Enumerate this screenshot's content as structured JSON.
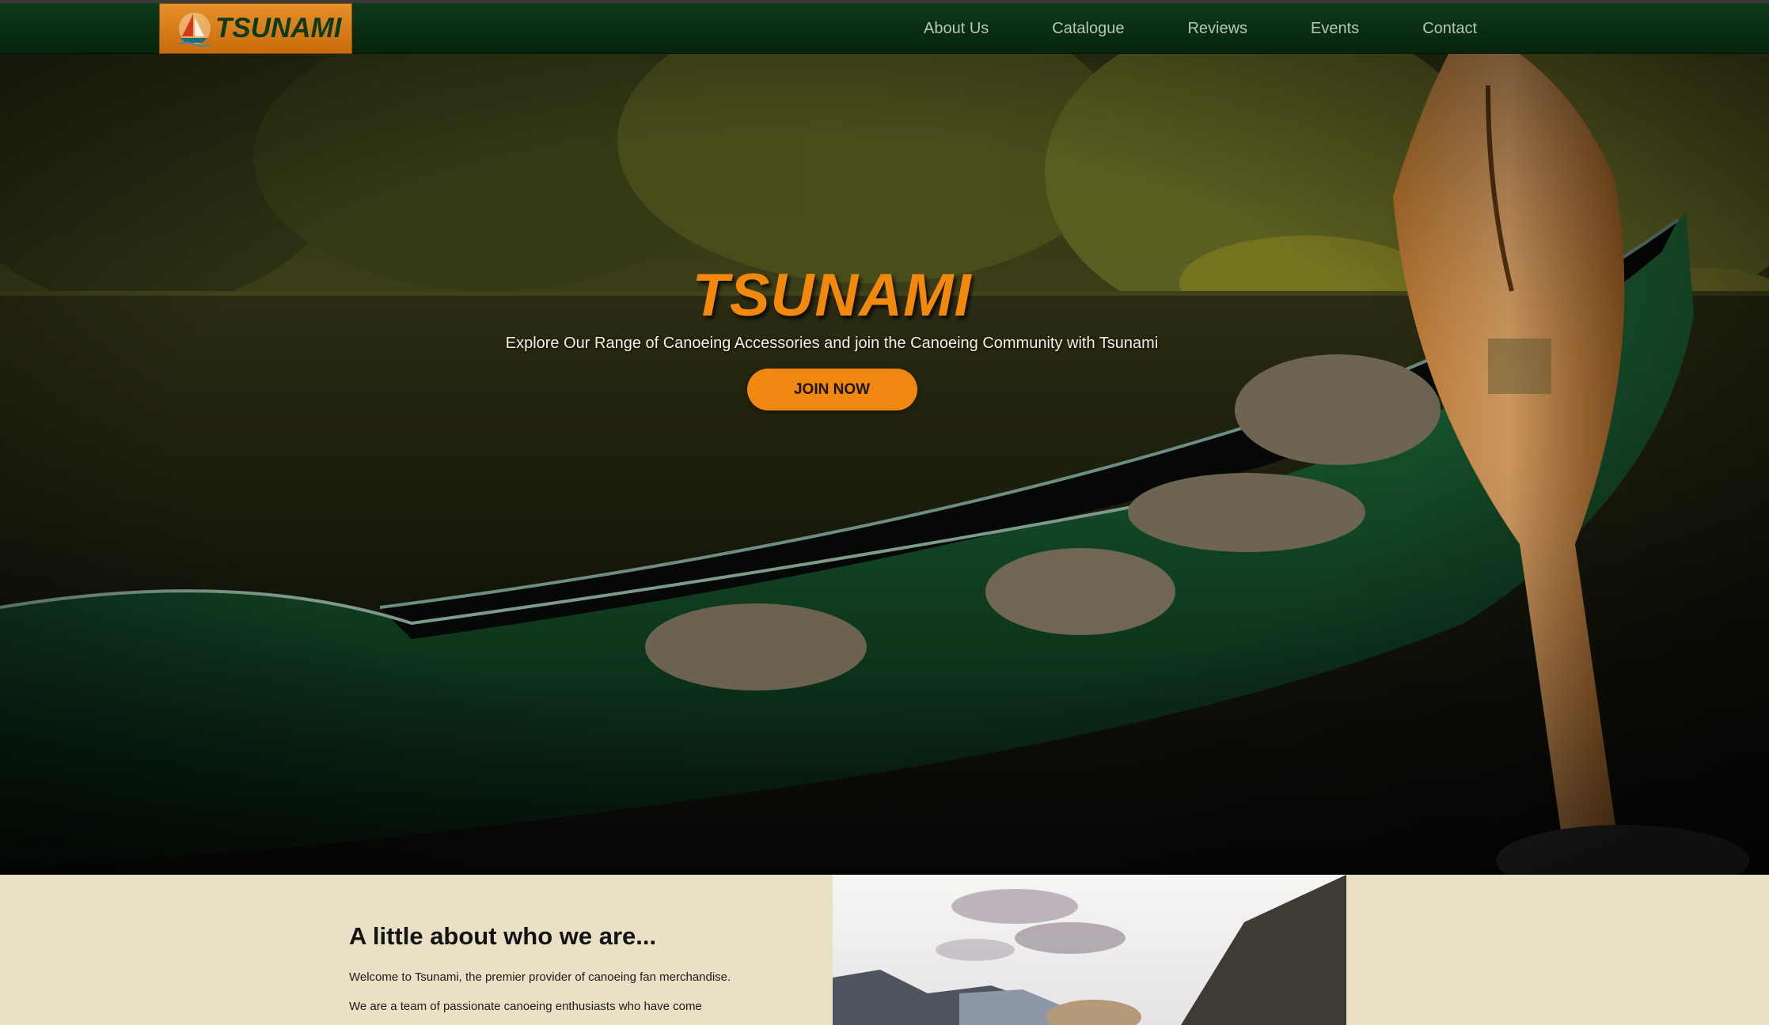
{
  "brand": {
    "logo_text": "TSUNAMI",
    "accent_orange": "#ef8711",
    "nav_green": "#082c12",
    "cream": "#e9e0c5"
  },
  "nav": {
    "items": [
      {
        "label": "About Us"
      },
      {
        "label": "Catalogue"
      },
      {
        "label": "Reviews"
      },
      {
        "label": "Events"
      },
      {
        "label": "Contact"
      }
    ]
  },
  "hero": {
    "title": "TSUNAMI",
    "subtitle": "Explore Our Range of Canoeing Accessories and join the Canoeing Community with Tsunami",
    "cta_label": "JOIN NOW"
  },
  "about": {
    "heading": "A little about who we are...",
    "paragraphs": [
      "Welcome to Tsunami, the premier provider of canoeing fan merchandise.",
      "We are a team of passionate canoeing enthusiasts who have come"
    ]
  },
  "icons": {
    "logo_mark": "sailboat-icon"
  }
}
